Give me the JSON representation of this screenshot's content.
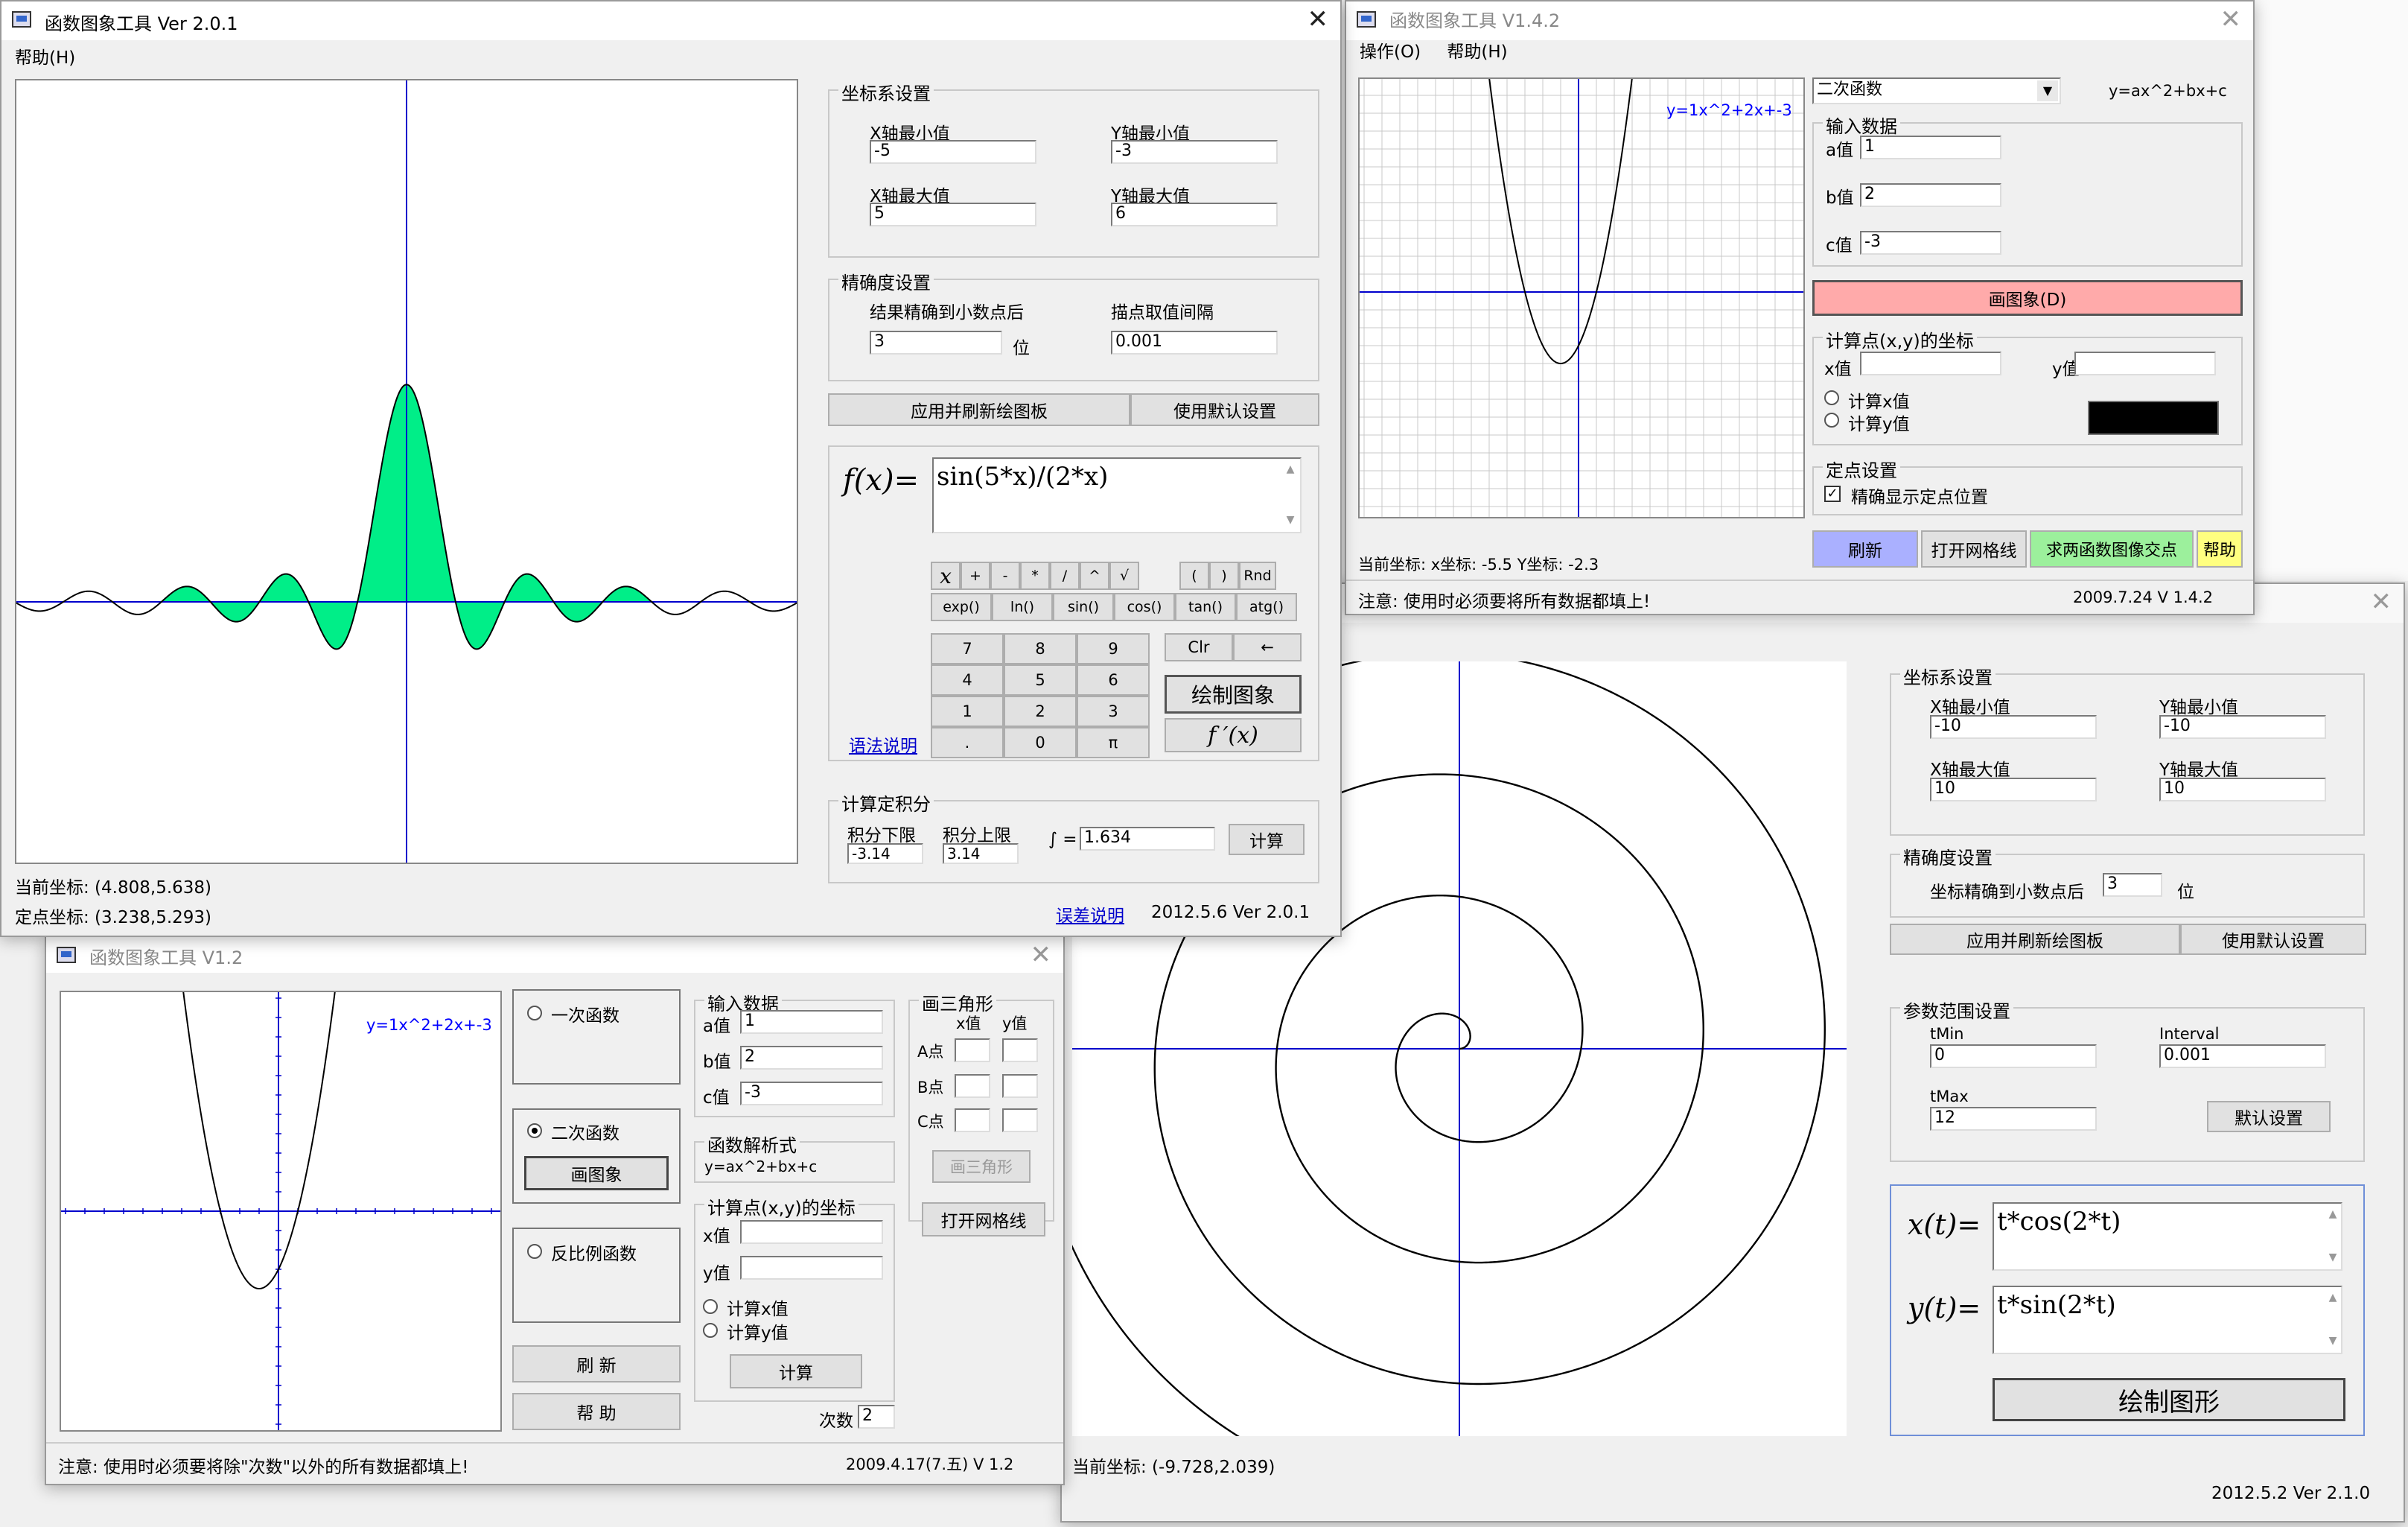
{
  "win_spiral": {
    "close_glyph": "✕",
    "section_coord": "坐标系设置",
    "x_min_label": "X轴最小值",
    "x_min_value": "-10",
    "y_min_label": "Y轴最小值",
    "y_min_value": "-10",
    "x_max_label": "X轴最大值",
    "x_max_value": "10",
    "y_max_label": "Y轴最大值",
    "y_max_value": "10",
    "section_precision": "精确度设置",
    "precision_label": "坐标精确到小数点后",
    "precision_value": "3",
    "precision_unit": "位",
    "apply_button": "应用并刷新绘图板",
    "default_button": "使用默认设置",
    "section_param": "参数范围设置",
    "tmin_label": "tMin",
    "tmin_value": "0",
    "interval_label": "Interval",
    "interval_value": "0.001",
    "tmax_label": "tMax",
    "tmax_value": "12",
    "param_default_button": "默认设置",
    "xt_label": "x(t)=",
    "xt_value": "t*cos(2*t)",
    "yt_label": "y(t)=",
    "yt_value": "t*sin(2*t)",
    "draw_button": "绘制图形",
    "status_coord": "当前坐标: (-9.728,2.039)",
    "version": "2012.5.2 Ver 2.1.0"
  },
  "win_v142": {
    "title": "函数图象工具 V1.4.2",
    "menu_ops": "操作(O)",
    "menu_help": "帮助(H)",
    "func_type": "二次函数",
    "formula_hint": "y=ax^2+bx+c",
    "graph_label": "y=1x^2+2x+-3",
    "section_input": "输入数据",
    "a_label": "a值",
    "a_value": "1",
    "b_label": "b值",
    "b_value": "2",
    "c_label": "c值",
    "c_value": "-3",
    "draw_button": "画图象(D)",
    "section_calc": "计算点(x,y)的坐标",
    "x_label": "x值",
    "y_label": "y值",
    "radio_calc_x": "计算x值",
    "radio_calc_y": "计算y值",
    "section_fixed": "定点设置",
    "check_precise": "精确显示定点位置",
    "btn_refresh": "刷新",
    "btn_grid": "打开网格线",
    "btn_intersect": "求两函数图像交点",
    "btn_help": "帮助",
    "status_coord": "当前坐标: x坐标: -5.5 Y坐标: -2.3",
    "note": "注意: 使用时必须要将所有数据都填上!",
    "version": "2009.7.24  V 1.4.2"
  },
  "win_v12": {
    "title": "函数图象工具 V1.2",
    "graph_label": "y=1x^2+2x+-3",
    "radio_linear": "一次函数",
    "radio_quadratic": "二次函数",
    "draw_button": "画图象",
    "radio_inverse": "反比例函数",
    "refresh_button": "刷 新",
    "help_button": "帮 助",
    "section_input": "输入数据",
    "a_label": "a值",
    "a_value": "1",
    "b_label": "b值",
    "b_value": "2",
    "c_label": "c值",
    "c_value": "-3",
    "section_formula": "函数解析式",
    "formula": "y=ax^2+bx+c",
    "section_calc": "计算点(x,y)的坐标",
    "x_label": "x值",
    "y_label": "y值",
    "radio_calc_x": "计算x值",
    "radio_calc_y": "计算y值",
    "calc_button": "计算",
    "power_label": "次数",
    "power_value": "2",
    "section_triangle": "画三角形",
    "tri_x_head": "x值",
    "tri_y_head": "y值",
    "point_a": "A点",
    "point_b": "B点",
    "point_c": "C点",
    "triangle_button": "画三角形",
    "grid_button": "打开网格线",
    "note": "注意: 使用时必须要将除\"次数\"以外的所有数据都填上!",
    "version": "2009.4.17(7.五) V 1.2"
  },
  "win_v201": {
    "title": "函数图象工具 Ver 2.0.1",
    "menu_help": "帮助(H)",
    "section_coord": "坐标系设置",
    "x_min_label": "X轴最小值",
    "x_min_value": "-5",
    "y_min_label": "Y轴最小值",
    "y_min_value": "-3",
    "x_max_label": "X轴最大值",
    "x_max_value": "5",
    "y_max_label": "Y轴最大值",
    "y_max_value": "6",
    "section_precision": "精确度设置",
    "result_precision_label": "结果精确到小数点后",
    "result_precision_value": "3",
    "precision_unit": "位",
    "interval_label": "描点取值间隔",
    "interval_value": "0.001",
    "apply_button": "应用并刷新绘图板",
    "default_button": "使用默认设置",
    "fx_label": "f(x)=",
    "fx_value": "sin(5*x)/(2*x)",
    "keys_row1": [
      "x",
      "+",
      "-",
      "*",
      "/",
      "^",
      "√",
      "(",
      ")",
      "Rnd"
    ],
    "keys_row2": [
      "exp()",
      "ln()",
      "sin()",
      "cos()",
      "tan()",
      "atg()"
    ],
    "num_keys": [
      "7",
      "8",
      "9",
      "4",
      "5",
      "6",
      "1",
      "2",
      "3",
      ".",
      "0",
      "π"
    ],
    "clr_key": "Clr",
    "back_key": "←",
    "draw_button": "绘制图象",
    "deriv_button": "f ′(x)",
    "syntax_link": "语法说明",
    "section_integral": "计算定积分",
    "lower_label": "积分下限",
    "lower_value": "-3.14",
    "upper_label": "积分上限",
    "upper_value": "3.14",
    "integral_sign": "∫ =",
    "integral_value": "1.634",
    "calc_button": "计算",
    "status_coord": "当前坐标: (4.808,5.638)",
    "fixed_coord": "定点坐标: (3.238,5.293)",
    "error_link": "误差说明",
    "version": "2012.5.6 Ver 2.0.1"
  }
}
